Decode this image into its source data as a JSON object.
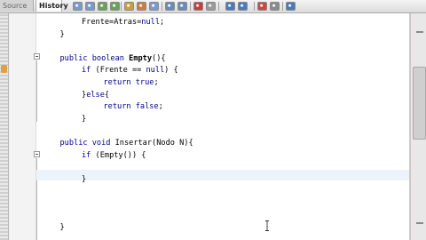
{
  "toolbar": {
    "tabs": [
      {
        "label": "Source",
        "active": false
      },
      {
        "label": "History",
        "active": true
      }
    ],
    "buttons": [
      "back-icon",
      "forward-icon",
      "find-previous-icon",
      "find-next-icon",
      "find-selection-icon",
      "toggle-highlight-icon",
      "toggle-rectangular-selection-icon",
      "shift-left-icon",
      "shift-right-icon",
      "start-macro-icon",
      "stop-macro-icon",
      "comment-icon",
      "uncomment-icon",
      "run-icon",
      "stop-icon",
      "more-icon"
    ]
  },
  "code": {
    "lines": [
      {
        "row": 0,
        "indent": 2,
        "text": "Frente=Atras=null;"
      },
      {
        "row": 1,
        "indent": 1,
        "text": "}"
      },
      {
        "row": 3,
        "indent": 1,
        "text": "public boolean Empty(){"
      },
      {
        "row": 4,
        "indent": 2,
        "text": "if (Frente == null) {"
      },
      {
        "row": 5,
        "indent": 3,
        "text": "return true;"
      },
      {
        "row": 6,
        "indent": 2,
        "text": "}else{"
      },
      {
        "row": 7,
        "indent": 3,
        "text": "return false;"
      },
      {
        "row": 8,
        "indent": 2,
        "text": "}"
      },
      {
        "row": 10,
        "indent": 1,
        "text": "public void Insertar(Nodo N){"
      },
      {
        "row": 11,
        "indent": 2,
        "text": "if (Empty()) {"
      },
      {
        "row": 13,
        "indent": 2,
        "text": "}"
      },
      {
        "row": 17,
        "indent": 1,
        "text": "}"
      }
    ],
    "current_row": 12
  },
  "colors": {
    "keyword": "#00008f",
    "text": "#000000",
    "current_line": "#edf3fb",
    "gutter": "#f3f3f3"
  }
}
